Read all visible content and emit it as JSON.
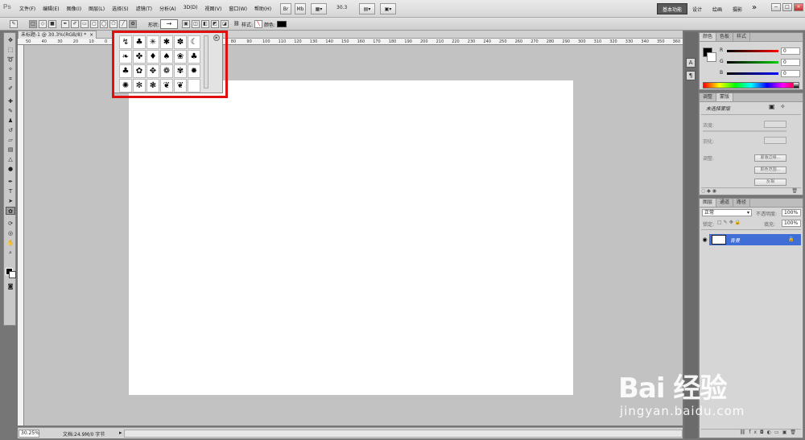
{
  "app": {
    "logo": "Ps"
  },
  "menubar": {
    "items": [
      "文件(F)",
      "编辑(E)",
      "图像(I)",
      "图层(L)",
      "选择(S)",
      "滤镜(T)",
      "分析(A)",
      "3D(D)",
      "视图(V)",
      "窗口(W)",
      "帮助(H)"
    ],
    "br_label": "Br",
    "mb_label": "Mb",
    "zoom": "30.3",
    "workspace": "基本功能",
    "workspace_links": [
      "设计",
      "绘画",
      "摄影"
    ],
    "more": "»",
    "win_controls": [
      "−",
      "□",
      "×"
    ]
  },
  "optbar": {
    "shape_label": "形状:",
    "shape_value": "→",
    "style_label": "样式:",
    "color_label": "颜色:",
    "color": "#000000"
  },
  "document": {
    "tab_title": "未标题-1 @ 30.3%(RGB/8) *",
    "close": "×",
    "ruler_marks": [
      "50",
      "40",
      "30",
      "20",
      "10",
      "0",
      "10",
      "20",
      "30",
      "40",
      "50",
      "60",
      "70",
      "80",
      "90",
      "100",
      "110",
      "120",
      "130",
      "140",
      "150",
      "160",
      "170",
      "180",
      "190",
      "200",
      "210",
      "220",
      "230",
      "240",
      "250",
      "260",
      "270",
      "280",
      "290",
      "300",
      "310",
      "320",
      "330",
      "340",
      "350",
      "360"
    ]
  },
  "shape_popup": {
    "shapes": [
      "↯",
      "♣",
      "✳",
      "✱",
      "✽",
      "☾",
      "❧",
      "✤",
      "♦",
      "♠",
      "❀",
      "♣",
      "♣",
      "✿",
      "✥",
      "❁",
      "✾",
      "✹",
      "✺",
      "✻",
      "❃",
      "❦",
      "❦",
      ""
    ],
    "menu_icon": "▸"
  },
  "status": {
    "zoom": "30.25%",
    "doc_info": "文档:24.9M/0 字节"
  },
  "color_panel": {
    "tabs": [
      "颜色",
      "色板",
      "样式"
    ],
    "channels": [
      {
        "label": "R",
        "value": "0",
        "color": "#e01010"
      },
      {
        "label": "G",
        "value": "0",
        "color": "#10a010"
      },
      {
        "label": "B",
        "value": "0",
        "color": "#1010e0"
      }
    ]
  },
  "mask_panel": {
    "tabs": [
      "调整",
      "蒙版"
    ],
    "title": "未选择蒙版",
    "density_label": "浓度:",
    "feather_label": "羽化:",
    "refine_label": "调整:",
    "buttons": [
      "蒙版边缘...",
      "颜色范围...",
      "反相"
    ]
  },
  "layers_panel": {
    "tabs": [
      "图层",
      "通道",
      "路径"
    ],
    "blend_mode": "正常",
    "opacity_label": "不透明度:",
    "opacity": "100%",
    "lock_label": "锁定:",
    "fill_label": "填充:",
    "fill": "100%",
    "layers": [
      {
        "name": "背景"
      }
    ]
  },
  "watermark": {
    "brand": "Bai 经验",
    "url": "jingyan.baidu.com"
  }
}
